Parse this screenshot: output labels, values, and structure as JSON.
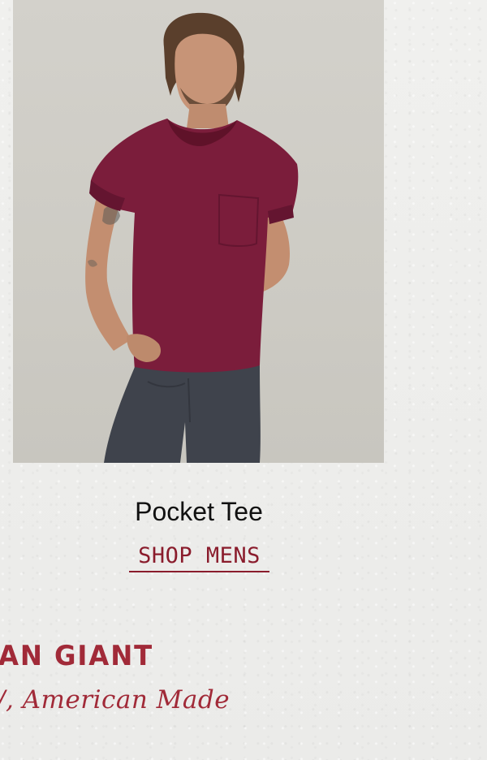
{
  "product": {
    "image_alt": "Man wearing maroon pocket tee and charcoal pants",
    "title": "Pocket Tee",
    "cta": "SHOP MENS"
  },
  "brand": {
    "name": "AN GIANT",
    "tagline": "/, American Made"
  },
  "colors": {
    "accent": "#a12a38",
    "link": "#8a1c2c",
    "tee": "#7a1c3a",
    "pants": "#3f434c"
  }
}
